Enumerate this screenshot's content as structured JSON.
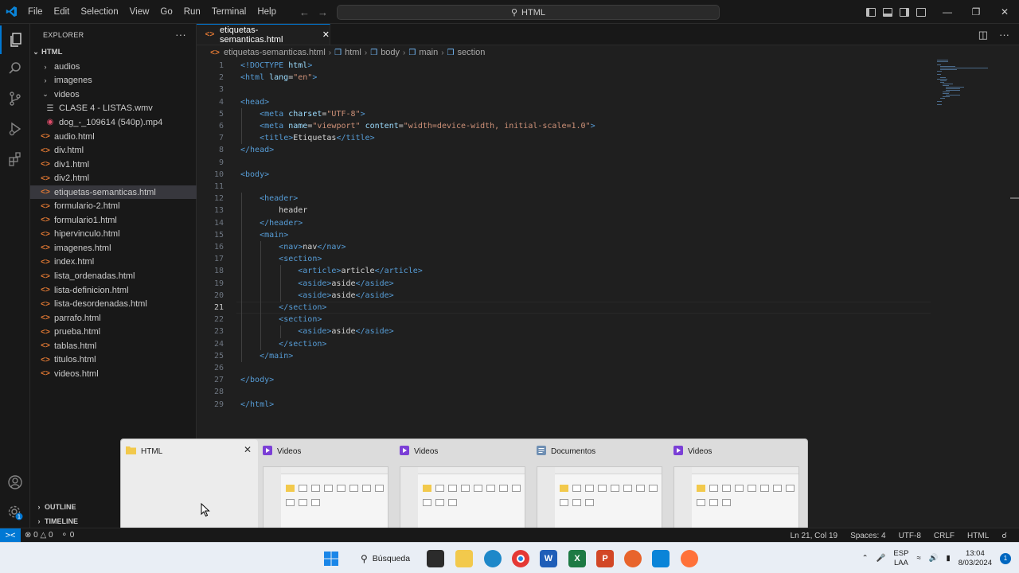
{
  "window": {
    "menu": [
      "File",
      "Edit",
      "Selection",
      "View",
      "Go",
      "Run",
      "Terminal",
      "Help"
    ],
    "command_center": "HTML"
  },
  "sidebar": {
    "title": "EXPLORER",
    "more": "···",
    "root": "HTML",
    "tree": [
      {
        "label": "audios",
        "depth": 1,
        "kind": "folder",
        "open": false
      },
      {
        "label": "imagenes",
        "depth": 1,
        "kind": "folder",
        "open": false
      },
      {
        "label": "videos",
        "depth": 1,
        "kind": "folder",
        "open": true
      },
      {
        "label": "CLASE 4 - LISTAS.wmv",
        "depth": 2,
        "kind": "list"
      },
      {
        "label": "dog_-_109614 (540p).mp4",
        "depth": 2,
        "kind": "video"
      },
      {
        "label": "audio.html",
        "depth": 1,
        "kind": "html"
      },
      {
        "label": "div.html",
        "depth": 1,
        "kind": "html"
      },
      {
        "label": "div1.html",
        "depth": 1,
        "kind": "html"
      },
      {
        "label": "div2.html",
        "depth": 1,
        "kind": "html"
      },
      {
        "label": "etiquetas-semanticas.html",
        "depth": 1,
        "kind": "html",
        "selected": true
      },
      {
        "label": "formulario-2.html",
        "depth": 1,
        "kind": "html"
      },
      {
        "label": "formulario1.html",
        "depth": 1,
        "kind": "html"
      },
      {
        "label": "hipervinculo.html",
        "depth": 1,
        "kind": "html"
      },
      {
        "label": "imagenes.html",
        "depth": 1,
        "kind": "html"
      },
      {
        "label": "index.html",
        "depth": 1,
        "kind": "html"
      },
      {
        "label": "lista_ordenadas.html",
        "depth": 1,
        "kind": "html"
      },
      {
        "label": "lista-definicion.html",
        "depth": 1,
        "kind": "html"
      },
      {
        "label": "lista-desordenadas.html",
        "depth": 1,
        "kind": "html"
      },
      {
        "label": "parrafo.html",
        "depth": 1,
        "kind": "html"
      },
      {
        "label": "prueba.html",
        "depth": 1,
        "kind": "html"
      },
      {
        "label": "tablas.html",
        "depth": 1,
        "kind": "html"
      },
      {
        "label": "titulos.html",
        "depth": 1,
        "kind": "html"
      },
      {
        "label": "videos.html",
        "depth": 1,
        "kind": "html"
      }
    ],
    "outline": "OUTLINE",
    "timeline": "TIMELINE"
  },
  "editor": {
    "tab": "etiquetas-semanticas.html",
    "breadcrumb": [
      "etiquetas-semanticas.html",
      "html",
      "body",
      "main",
      "section"
    ],
    "current_line": 21,
    "lines": [
      [
        [
          "t",
          "<!DOCTYPE "
        ],
        [
          "a",
          "html"
        ],
        [
          "t",
          ">"
        ]
      ],
      [
        [
          "t",
          "<html "
        ],
        [
          "a",
          "lang"
        ],
        [
          "x",
          "="
        ],
        [
          "s",
          "\"en\""
        ],
        [
          "t",
          ">"
        ]
      ],
      [],
      [
        [
          "t",
          "<head>"
        ]
      ],
      [
        [
          "x",
          "    "
        ],
        [
          "t",
          "<meta "
        ],
        [
          "a",
          "charset"
        ],
        [
          "x",
          "="
        ],
        [
          "s",
          "\"UTF-8\""
        ],
        [
          "t",
          ">"
        ]
      ],
      [
        [
          "x",
          "    "
        ],
        [
          "t",
          "<meta "
        ],
        [
          "a",
          "name"
        ],
        [
          "x",
          "="
        ],
        [
          "s",
          "\"viewport\""
        ],
        [
          "x",
          " "
        ],
        [
          "a",
          "content"
        ],
        [
          "x",
          "="
        ],
        [
          "s",
          "\"width=device-width, initial-scale=1.0\""
        ],
        [
          "t",
          ">"
        ]
      ],
      [
        [
          "x",
          "    "
        ],
        [
          "t",
          "<title>"
        ],
        [
          "x",
          "Etiquetas"
        ],
        [
          "t",
          "</title>"
        ]
      ],
      [
        [
          "t",
          "</head>"
        ]
      ],
      [],
      [
        [
          "t",
          "<body>"
        ]
      ],
      [],
      [
        [
          "x",
          "    "
        ],
        [
          "t",
          "<header>"
        ]
      ],
      [
        [
          "x",
          "        header"
        ]
      ],
      [
        [
          "x",
          "    "
        ],
        [
          "t",
          "</header>"
        ]
      ],
      [
        [
          "x",
          "    "
        ],
        [
          "t",
          "<main>"
        ]
      ],
      [
        [
          "x",
          "        "
        ],
        [
          "t",
          "<nav>"
        ],
        [
          "x",
          "nav"
        ],
        [
          "t",
          "</nav>"
        ]
      ],
      [
        [
          "x",
          "        "
        ],
        [
          "t",
          "<section>"
        ]
      ],
      [
        [
          "x",
          "            "
        ],
        [
          "t",
          "<article>"
        ],
        [
          "x",
          "article"
        ],
        [
          "t",
          "</article>"
        ]
      ],
      [
        [
          "x",
          "            "
        ],
        [
          "t",
          "<aside>"
        ],
        [
          "x",
          "aside"
        ],
        [
          "t",
          "</aside>"
        ]
      ],
      [
        [
          "x",
          "            "
        ],
        [
          "t",
          "<aside>"
        ],
        [
          "x",
          "aside"
        ],
        [
          "t",
          "</aside>"
        ]
      ],
      [
        [
          "x",
          "        "
        ],
        [
          "t",
          "</section>"
        ]
      ],
      [
        [
          "x",
          "        "
        ],
        [
          "t",
          "<section>"
        ]
      ],
      [
        [
          "x",
          "            "
        ],
        [
          "t",
          "<aside>"
        ],
        [
          "x",
          "aside"
        ],
        [
          "t",
          "</aside>"
        ]
      ],
      [
        [
          "x",
          "        "
        ],
        [
          "t",
          "</section>"
        ]
      ],
      [
        [
          "x",
          "    "
        ],
        [
          "t",
          "</main>"
        ]
      ],
      [],
      [
        [
          "t",
          "</body>"
        ]
      ],
      [],
      [
        [
          "t",
          "</html>"
        ]
      ]
    ]
  },
  "task_view": {
    "windows": [
      {
        "title": "HTML",
        "app": "file-explorer",
        "selected": true
      },
      {
        "title": "Videos",
        "app": "media-player"
      },
      {
        "title": "Videos",
        "app": "media-player"
      },
      {
        "title": "Documentos",
        "app": "notepad"
      },
      {
        "title": "Videos",
        "app": "media-player"
      }
    ]
  },
  "statusbar": {
    "remote": "><",
    "errors": "0",
    "warnings": "0",
    "ports": "0",
    "position": "Ln 21, Col 19",
    "spaces": "Spaces: 4",
    "encoding": "UTF-8",
    "eol": "CRLF",
    "language": "HTML"
  },
  "taskbar": {
    "search": "Búsqueda",
    "lang": "ESP",
    "layout": "LAA",
    "time": "13:04",
    "date": "8/03/2024",
    "notifications": "1"
  },
  "colors": {
    "accent": "#0078d4",
    "tag": "#569cd6",
    "attr": "#9cdcfe",
    "string": "#ce9178",
    "html_icon": "#e37933"
  }
}
